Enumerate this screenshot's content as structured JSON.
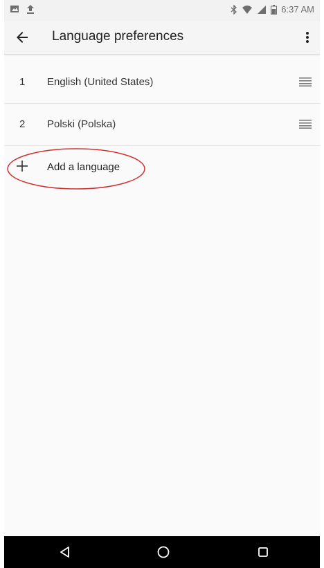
{
  "status_bar": {
    "time": "6:37 AM",
    "left_icons": [
      "image-icon",
      "upload-icon"
    ],
    "right_icons": [
      "bluetooth-icon",
      "wifi-icon",
      "signal-icon",
      "battery-icon"
    ]
  },
  "app_bar": {
    "title": "Language preferences",
    "back_icon": "arrow-back-icon",
    "menu_icon": "more-vert-icon"
  },
  "languages": [
    {
      "index": "1",
      "name": "English (United States)"
    },
    {
      "index": "2",
      "name": "Polski (Polska)"
    }
  ],
  "add_language": {
    "label": "Add a language",
    "icon": "plus-icon"
  },
  "highlight": {
    "color": "#d32f2f"
  },
  "nav_bar": {
    "buttons": [
      "back-triangle-icon",
      "home-circle-icon",
      "recents-square-icon"
    ]
  }
}
